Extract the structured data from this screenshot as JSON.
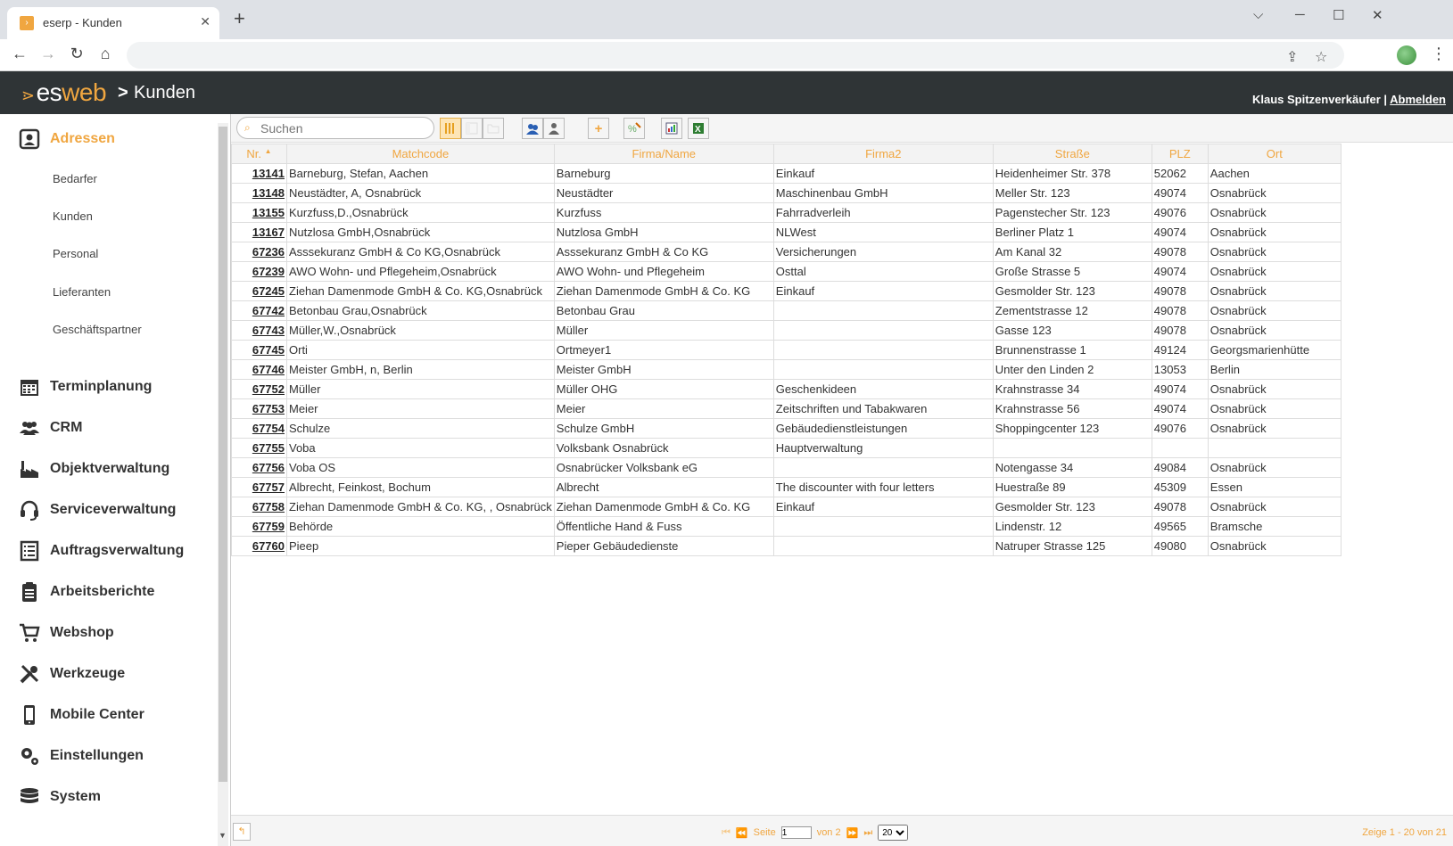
{
  "browser": {
    "tab_title": "eserp - Kunden",
    "tab_close": "✕",
    "new_tab": "+",
    "min": "⌵",
    "min2": "─",
    "max": "☐",
    "close": "✕",
    "back": "←",
    "forward": "→",
    "reload": "↻",
    "home": "⌂",
    "share": "⇪",
    "star": "☆",
    "menu": "⋮"
  },
  "app": {
    "logo_es": "es",
    "logo_web": "web",
    "breadcrumb_sep": ">",
    "page_title": "Kunden",
    "user_name": "Klaus Spitzenverkäufer",
    "separator": " | ",
    "logout": "Abmelden"
  },
  "sidebar": {
    "sections": [
      {
        "label": "Adressen",
        "icon": "address-book-icon",
        "active": true
      },
      {
        "label": "Terminplanung",
        "icon": "calendar-icon"
      },
      {
        "label": "CRM",
        "icon": "users-icon"
      },
      {
        "label": "Objektverwaltung",
        "icon": "factory-icon"
      },
      {
        "label": "Serviceverwaltung",
        "icon": "headset-icon"
      },
      {
        "label": "Auftragsverwaltung",
        "icon": "list-icon"
      },
      {
        "label": "Arbeitsberichte",
        "icon": "clipboard-icon"
      },
      {
        "label": "Webshop",
        "icon": "cart-icon"
      },
      {
        "label": "Werkzeuge",
        "icon": "tools-icon"
      },
      {
        "label": "Mobile Center",
        "icon": "mobile-icon"
      },
      {
        "label": "Einstellungen",
        "icon": "gears-icon"
      },
      {
        "label": "System",
        "icon": "database-icon"
      }
    ],
    "sub_items": [
      "Bedarfer",
      "Kunden",
      "Personal",
      "Lieferanten",
      "Geschäftspartner"
    ],
    "scroll_down": "▼"
  },
  "toolbar": {
    "search_placeholder": "Suchen",
    "search_icon": "⌕",
    "add": "+"
  },
  "table": {
    "columns": [
      "Nr.",
      "Matchcode",
      "Firma/Name",
      "Firma2",
      "Straße",
      "PLZ",
      "Ort"
    ],
    "sort_indicator": "▲",
    "rows": [
      [
        "13141",
        "Barneburg, Stefan, Aachen",
        "Barneburg",
        "Einkauf",
        "Heidenheimer Str. 378",
        "52062",
        "Aachen"
      ],
      [
        "13148",
        "Neustädter, A, Osnabrück",
        "Neustädter",
        "Maschinenbau GmbH",
        "Meller Str. 123",
        "49074",
        "Osnabrück"
      ],
      [
        "13155",
        "Kurzfuss,D.,Osnabrück",
        "Kurzfuss",
        "Fahrradverleih",
        "Pagenstecher Str. 123",
        "49076",
        "Osnabrück"
      ],
      [
        "13167",
        "Nutzlosa GmbH,Osnabrück",
        "Nutzlosa GmbH",
        "NLWest",
        "Berliner Platz 1",
        "49074",
        "Osnabrück"
      ],
      [
        "67236",
        "Asssekuranz GmbH & Co KG,Osnabrück",
        "Asssekuranz GmbH & Co KG",
        "Versicherungen",
        "Am Kanal 32",
        "49078",
        "Osnabrück"
      ],
      [
        "67239",
        "AWO Wohn- und Pflegeheim,Osnabrück",
        "AWO Wohn- und Pflegeheim",
        "Osttal",
        "Große Strasse 5",
        "49074",
        "Osnabrück"
      ],
      [
        "67245",
        "Ziehan Damenmode GmbH & Co. KG,Osnabrück",
        "Ziehan Damenmode GmbH & Co. KG",
        "Einkauf",
        "Gesmolder Str. 123",
        "49078",
        "Osnabrück"
      ],
      [
        "67742",
        "Betonbau Grau,Osnabrück",
        "Betonbau Grau",
        "",
        "Zementstrasse 12",
        "49078",
        "Osnabrück"
      ],
      [
        "67743",
        "Müller,W.,Osnabrück",
        "Müller",
        "",
        "Gasse 123",
        "49078",
        "Osnabrück"
      ],
      [
        "67745",
        "Orti",
        "Ortmeyer1",
        "",
        "Brunnenstrasse 1",
        "49124",
        "Georgsmarienhütte"
      ],
      [
        "67746",
        "Meister GmbH, n, Berlin",
        "Meister GmbH",
        "",
        "Unter den Linden 2",
        "13053",
        "Berlin"
      ],
      [
        "67752",
        "Müller",
        "Müller OHG",
        "Geschenkideen",
        "Krahnstrasse 34",
        "49074",
        "Osnabrück"
      ],
      [
        "67753",
        "Meier",
        "Meier",
        "Zeitschriften und Tabakwaren",
        "Krahnstrasse 56",
        "49074",
        "Osnabrück"
      ],
      [
        "67754",
        "Schulze",
        "Schulze GmbH",
        "Gebäudedienstleistungen",
        "Shoppingcenter 123",
        "49076",
        "Osnabrück"
      ],
      [
        "67755",
        "Voba",
        "Volksbank Osnabrück",
        "Hauptverwaltung",
        "",
        "",
        ""
      ],
      [
        "67756",
        "Voba OS",
        "Osnabrücker Volksbank eG",
        "",
        "Notengasse 34",
        "49084",
        "Osnabrück"
      ],
      [
        "67757",
        "Albrecht, Feinkost, Bochum",
        "Albrecht",
        "The discounter with four letters",
        "Huestraße 89",
        "45309",
        "Essen"
      ],
      [
        "67758",
        "Ziehan Damenmode GmbH & Co. KG, , Osnabrück",
        "Ziehan Damenmode GmbH & Co. KG",
        "Einkauf",
        "Gesmolder Str. 123",
        "49078",
        "Osnabrück"
      ],
      [
        "67759",
        "Behörde",
        "Öffentliche Hand & Fuss",
        "",
        "Lindenstr. 12",
        "49565",
        "Bramsche"
      ],
      [
        "67760",
        "Pieep",
        "Pieper Gebäudedienste",
        "",
        "Natruper Strasse 125",
        "49080",
        "Osnabrück"
      ]
    ]
  },
  "footer": {
    "back": "↰",
    "first": "⏮",
    "prev": "⏪",
    "page_label": "Seite",
    "page_value": "1",
    "of_label": "von 2",
    "next": "⏩",
    "last": "⏭",
    "page_size": "20",
    "status": "Zeige 1 - 20 von 21"
  },
  "colors": {
    "accent": "#f0a640",
    "header_bg": "#2f3436"
  }
}
